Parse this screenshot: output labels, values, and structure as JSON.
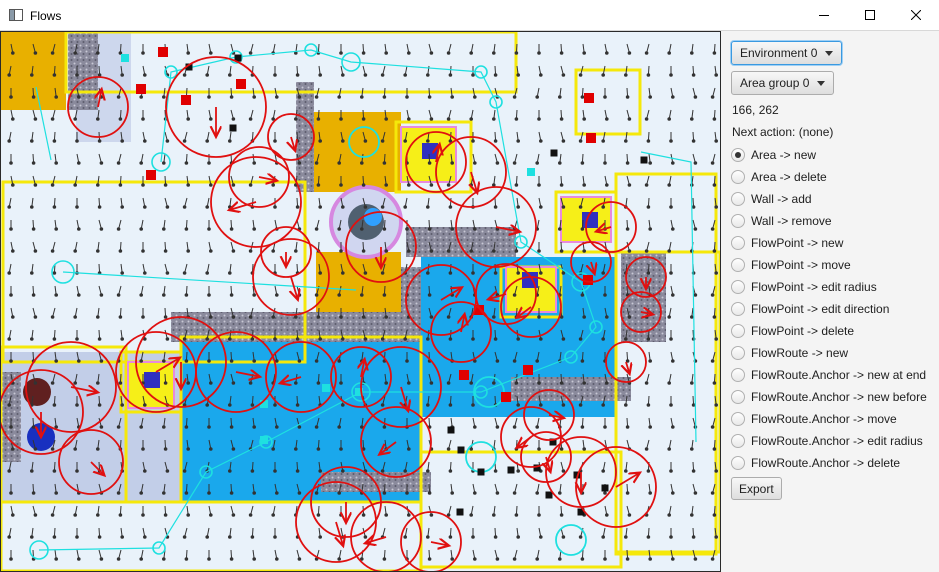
{
  "window": {
    "title": "Flows",
    "icons": {
      "app": "window-app-icon",
      "minimize": "minimize-icon",
      "maximize": "maximize-icon",
      "close": "close-icon"
    }
  },
  "panel": {
    "environment_select": {
      "value": "Environment 0",
      "icon": "chevron-down-icon"
    },
    "area_group_select": {
      "value": "Area group 0",
      "icon": "chevron-down-icon"
    },
    "coordinates": "166, 262",
    "next_action": "Next action: (none)",
    "actions": [
      {
        "label": "Area -> new",
        "selected": true
      },
      {
        "label": "Area -> delete",
        "selected": false
      },
      {
        "label": "Wall -> add",
        "selected": false
      },
      {
        "label": "Wall -> remove",
        "selected": false
      },
      {
        "label": "FlowPoint -> new",
        "selected": false
      },
      {
        "label": "FlowPoint -> move",
        "selected": false
      },
      {
        "label": "FlowPoint -> edit radius",
        "selected": false
      },
      {
        "label": "FlowPoint -> edit direction",
        "selected": false
      },
      {
        "label": "FlowPoint -> delete",
        "selected": false
      },
      {
        "label": "FlowRoute -> new",
        "selected": false
      },
      {
        "label": "FlowRoute.Anchor -> new at end",
        "selected": false
      },
      {
        "label": "FlowRoute.Anchor -> new before",
        "selected": false
      },
      {
        "label": "FlowRoute.Anchor -> move",
        "selected": false
      },
      {
        "label": "FlowRoute.Anchor -> edit radius",
        "selected": false
      },
      {
        "label": "FlowRoute.Anchor -> delete",
        "selected": false
      }
    ],
    "export_label": "Export"
  },
  "colors": {
    "flow_point": "#e01010",
    "route": "#1ee0e0",
    "area_border": "#f5e80a",
    "water": "#1aa8ec",
    "sand": "#e8b000",
    "wall": "#8b8b9c",
    "marker_red": "#e00000",
    "marker_black": "#111111",
    "goal_blue": "#3030c0"
  }
}
